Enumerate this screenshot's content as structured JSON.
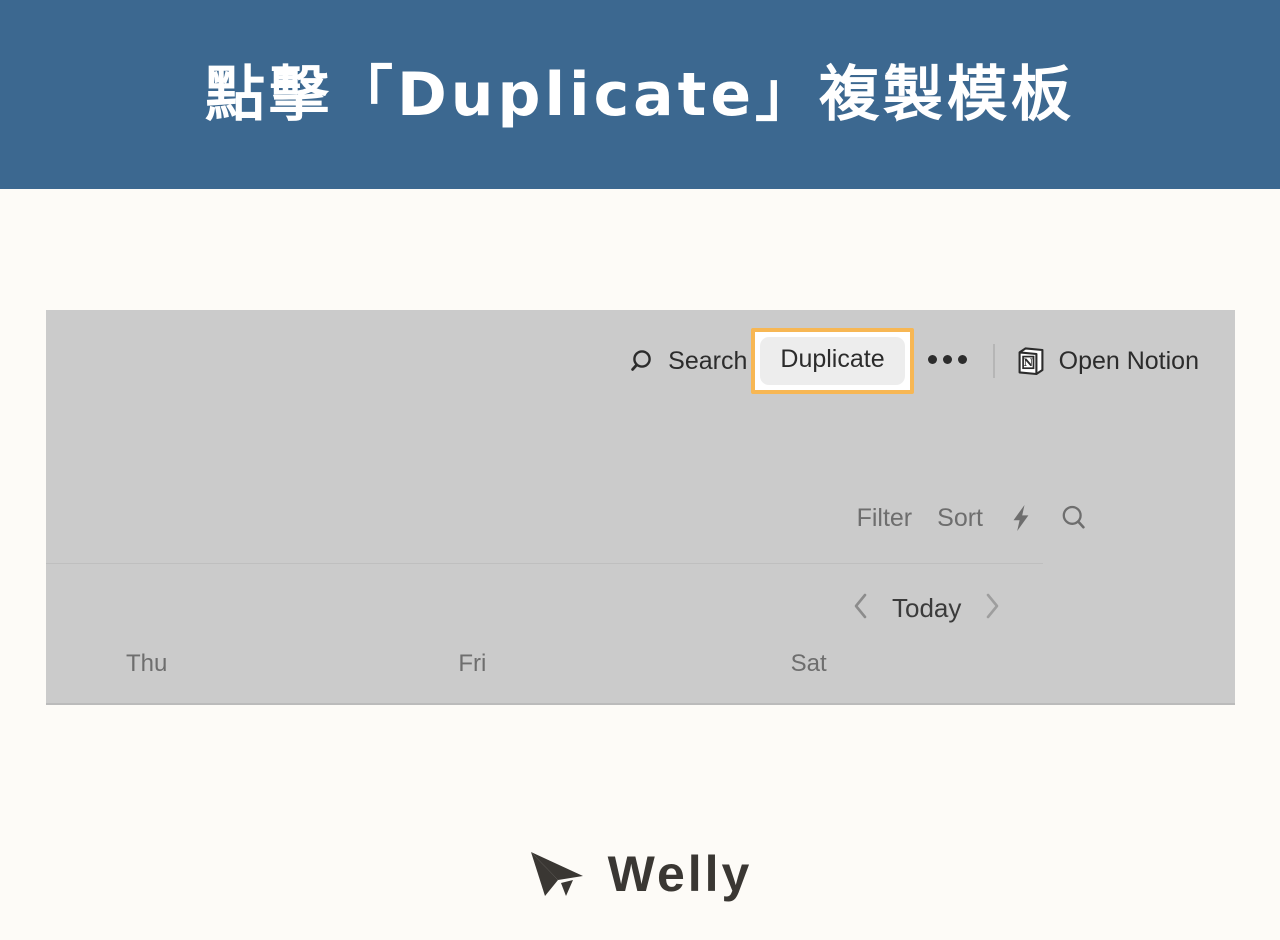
{
  "header": {
    "title": "點擊「Duplicate」複製模板",
    "background_color": "#3C6890",
    "text_color": "#FFFFFF"
  },
  "page": {
    "background_color": "#FDFBF7"
  },
  "screenshot": {
    "panel_color": "#CBCBCB",
    "notion_toolbar": {
      "search_icon": "search-icon",
      "search_label": "Search",
      "duplicate_label": "Duplicate",
      "more_menu_label": "•••",
      "notion_icon": "notion-logo-icon",
      "open_notion_label": "Open Notion",
      "highlight_color": "#F7B754"
    },
    "database_toolbar": {
      "filter_label": "Filter",
      "sort_label": "Sort",
      "automation_icon": "lightning-bolt-icon",
      "search_icon": "search-icon"
    },
    "date_nav": {
      "prev_icon": "chevron-left-icon",
      "today_label": "Today",
      "next_icon": "chevron-right-icon"
    },
    "calendar": {
      "weekdays": [
        "Thu",
        "Fri",
        "Sat"
      ]
    }
  },
  "footer": {
    "brand_name": "Welly",
    "brand_mark": "paper-plane-icon",
    "brand_color": "#3A3733"
  }
}
